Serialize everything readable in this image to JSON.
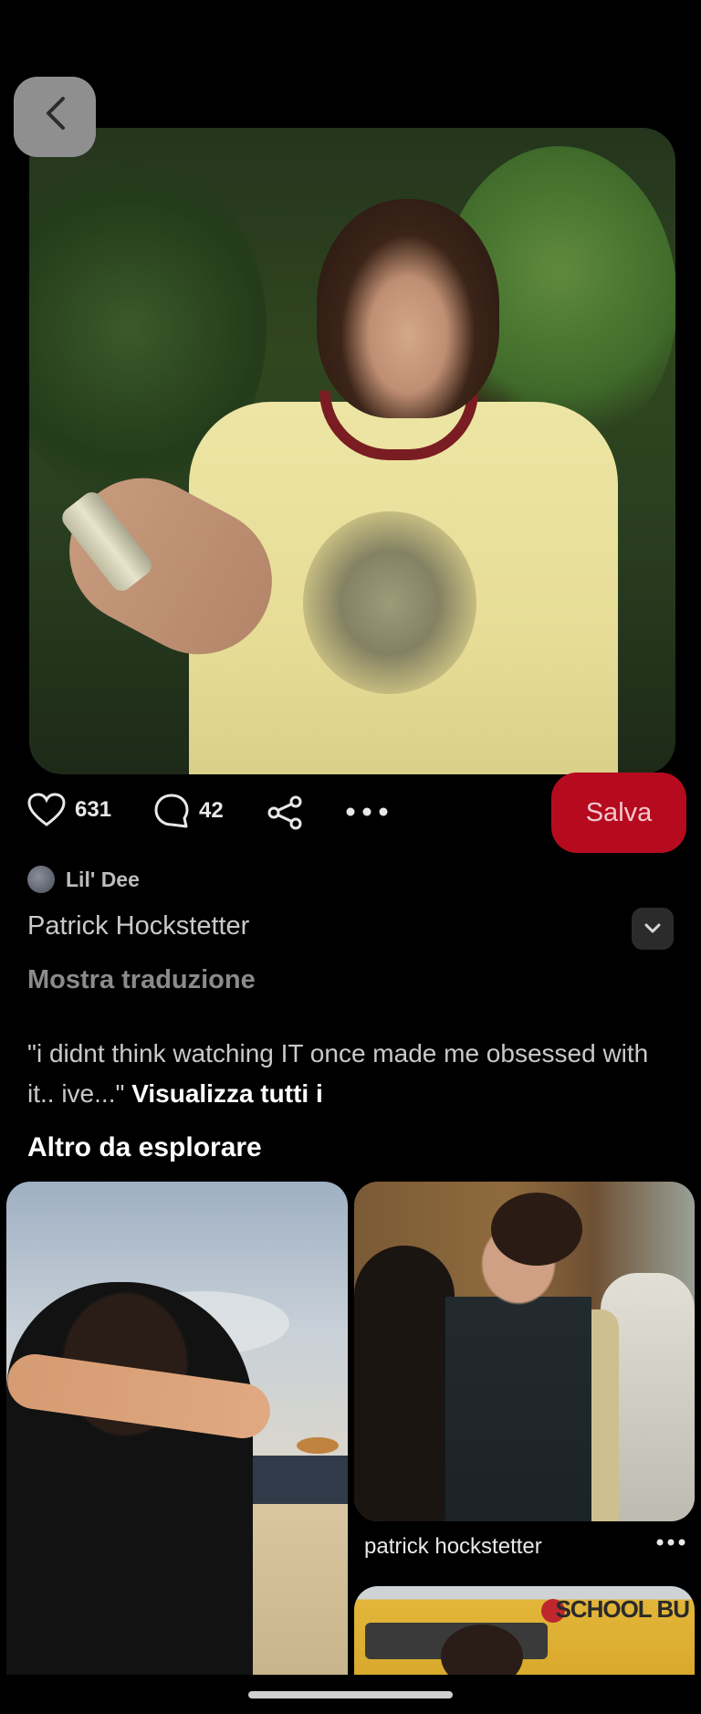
{
  "pin": {
    "likes": "631",
    "comments": "42",
    "save_label": "Salva",
    "author_name": "Lil' Dee",
    "title": "Patrick Hockstetter",
    "translate_label": "Mostra traduzione",
    "description": "\"i didnt think watching IT once made me obsessed with it.. ive...\"",
    "see_all_label": "Visualizza tutti i"
  },
  "explore": {
    "heading": "Altro da esplorare",
    "items": [
      {
        "title": ""
      },
      {
        "title": "patrick hockstetter"
      },
      {
        "title": "",
        "sign_text": "SCHOOL BU"
      }
    ]
  },
  "colors": {
    "background": "#000000",
    "save_button": "#b60b1e",
    "text_primary": "#ffffff",
    "text_secondary": "#c9c9c9",
    "text_muted": "#8b8b8b"
  },
  "icons": [
    "back-arrow-icon",
    "heart-icon",
    "comment-icon",
    "share-icon",
    "more-icon",
    "chevron-down-icon"
  ]
}
